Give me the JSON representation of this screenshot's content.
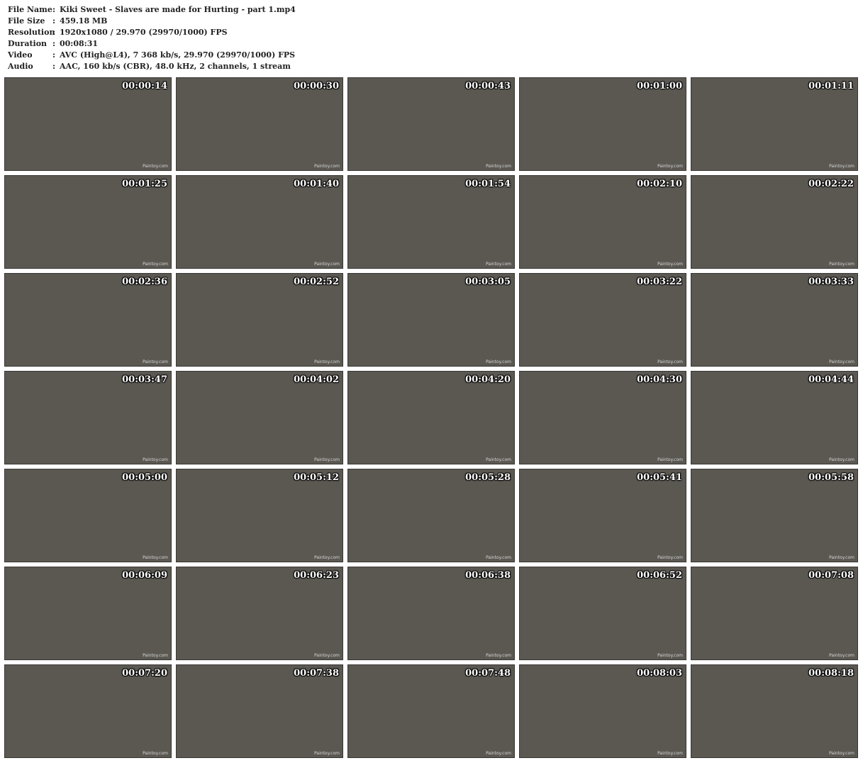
{
  "file_info": [
    {
      "label": "File Name",
      "value": "Kiki Sweet - Slaves are made for Hurting - part 1.mp4"
    },
    {
      "label": "File Size",
      "value": "459.18 MB"
    },
    {
      "label": "Resolution",
      "value": "1920x1080 / 29.970 (29970/1000) FPS"
    },
    {
      "label": "Duration",
      "value": "00:08:31"
    },
    {
      "label": "Video",
      "value": "AVC (High@L4), 7 368 kb/s, 29.970 (29970/1000) FPS"
    },
    {
      "label": "Audio",
      "value": "AAC, 160 kb/s (CBR), 48.0 kHz, 2 channels, 1 stream"
    }
  ],
  "separator": ":",
  "watermark": "Paintoy.com",
  "timestamps": [
    "00:00:14",
    "00:00:30",
    "00:00:43",
    "00:01:00",
    "00:01:11",
    "00:01:25",
    "00:01:40",
    "00:01:54",
    "00:02:10",
    "00:02:22",
    "00:02:36",
    "00:02:52",
    "00:03:05",
    "00:03:22",
    "00:03:33",
    "00:03:47",
    "00:04:02",
    "00:04:20",
    "00:04:30",
    "00:04:44",
    "00:05:00",
    "00:05:12",
    "00:05:28",
    "00:05:41",
    "00:05:58",
    "00:06:09",
    "00:06:23",
    "00:06:38",
    "00:06:52",
    "00:07:08",
    "00:07:20",
    "00:07:38",
    "00:07:48",
    "00:08:03",
    "00:08:18"
  ]
}
